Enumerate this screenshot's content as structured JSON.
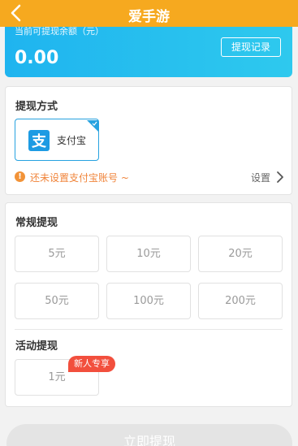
{
  "app_title": "爱手游",
  "balance": {
    "label": "当前可提现余额（元）",
    "amount": "0.00",
    "record_button": "提现记录"
  },
  "withdraw_method": {
    "title": "提现方式",
    "option_label": "支付宝",
    "option_icon": "alipay-icon",
    "warning_text": "还未设置支付宝账号 ~",
    "settings_label": "设置"
  },
  "regular": {
    "title": "常规提现",
    "amounts": [
      "5元",
      "10元",
      "20元",
      "50元",
      "100元",
      "200元"
    ]
  },
  "activity": {
    "title": "活动提现",
    "amount": "1元",
    "badge": "新人专享"
  },
  "submit_label": "立即提现",
  "colors": {
    "topbar": "#f6a91f",
    "balance_start": "#1fb4ef",
    "balance_end": "#2ec9ee",
    "warning": "#f0843a",
    "badge": "#f24f3d",
    "alipay": "#1d9be3"
  }
}
